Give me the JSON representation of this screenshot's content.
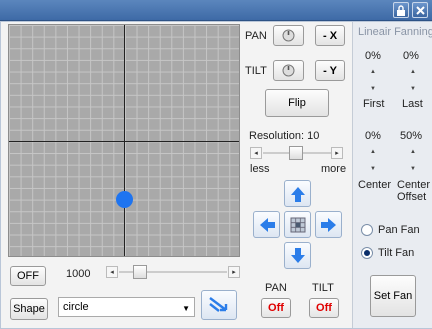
{
  "titlebar": {
    "icons": [
      "lock-icon",
      "close-icon"
    ]
  },
  "left": {
    "off_label": "OFF",
    "value": "1000",
    "shape_label": "Shape",
    "shape_value": "circle"
  },
  "middle": {
    "pan_label": "PAN",
    "tilt_label": "TILT",
    "minus_x": "- X",
    "minus_y": "- Y",
    "flip_label": "Flip",
    "resolution_label": "Resolution: 10",
    "less_label": "less",
    "more_label": "more",
    "pan_bottom_label": "PAN",
    "tilt_bottom_label": "TILT",
    "pan_off": "Off",
    "tilt_off": "Off",
    "resolution": {
      "min": 1,
      "max": 20,
      "value": 10
    }
  },
  "right": {
    "title": "Lineair Fanning",
    "first_value": "0%",
    "last_value": "0%",
    "first_label": "First",
    "last_label": "Last",
    "center_value": "0%",
    "offset_value": "50%",
    "center_label": "Center",
    "offset_label": "Center Offset",
    "pan_fan": "Pan Fan",
    "tilt_fan": "Tilt Fan",
    "selected_fan": "tilt",
    "set_fan": "Set Fan"
  },
  "colors": {
    "dot": "#1e74f0",
    "arrow": "#2b7de9",
    "off_text": "#e00000"
  }
}
